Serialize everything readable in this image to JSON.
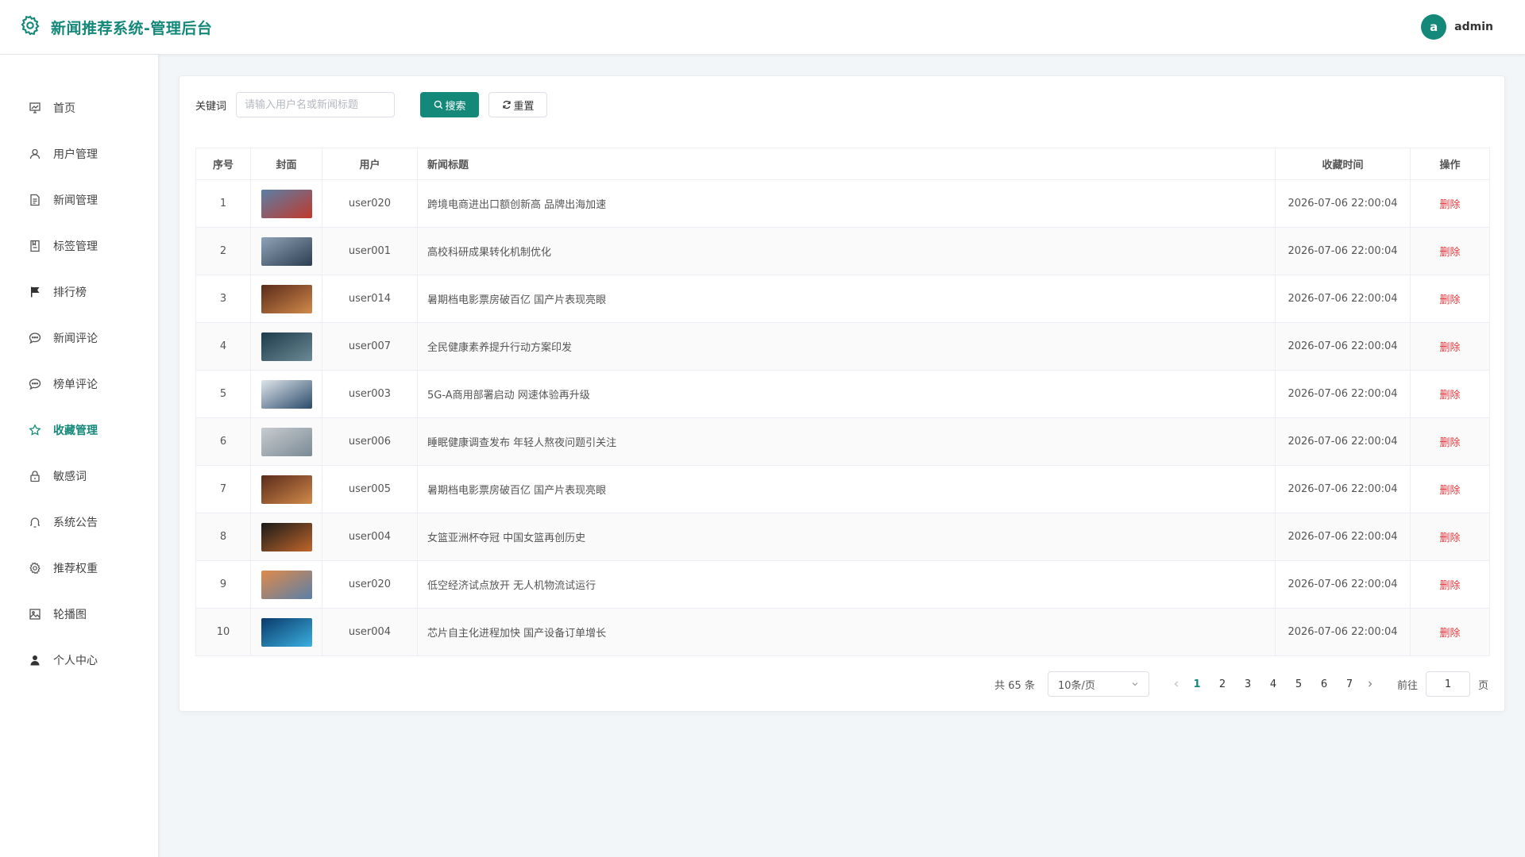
{
  "header": {
    "title": "新闻推荐系统-管理后台",
    "user_avatar": "a",
    "username": "admin",
    "accent": "#14897a"
  },
  "sidebar": {
    "items": [
      {
        "label": "首页",
        "icon": "dashboard-icon"
      },
      {
        "label": "用户管理",
        "icon": "user-icon"
      },
      {
        "label": "新闻管理",
        "icon": "document-icon"
      },
      {
        "label": "标签管理",
        "icon": "tag-icon"
      },
      {
        "label": "排行榜",
        "icon": "flag-icon"
      },
      {
        "label": "新闻评论",
        "icon": "comment-icon"
      },
      {
        "label": "榜单评论",
        "icon": "comment-icon"
      },
      {
        "label": "收藏管理",
        "icon": "star-icon",
        "active": true
      },
      {
        "label": "敏感词",
        "icon": "lock-icon"
      },
      {
        "label": "系统公告",
        "icon": "bell-icon"
      },
      {
        "label": "推荐权重",
        "icon": "gear-icon"
      },
      {
        "label": "轮播图",
        "icon": "image-icon"
      },
      {
        "label": "个人中心",
        "icon": "person-icon"
      }
    ]
  },
  "search": {
    "label": "关键词",
    "placeholder": "请输入用户名或新闻标题",
    "value": "",
    "search_label": "搜索",
    "reset_label": "重置"
  },
  "table": {
    "columns": [
      "序号",
      "封面",
      "用户",
      "新闻标题",
      "收藏时间",
      "操作"
    ],
    "delete_label": "删除",
    "rows": [
      {
        "no": "1",
        "user": "user020",
        "title": "跨境电商进出口额创新高 品牌出海加速",
        "time": "2026-07-06 22:00:04",
        "cover": [
          "#5a7fa8",
          "#c0392b"
        ]
      },
      {
        "no": "2",
        "user": "user001",
        "title": "高校科研成果转化机制优化",
        "time": "2026-07-06 22:00:04",
        "cover": [
          "#8fa3b8",
          "#2c3e50"
        ]
      },
      {
        "no": "3",
        "user": "user014",
        "title": "暑期档电影票房破百亿 国产片表现亮眼",
        "time": "2026-07-06 22:00:04",
        "cover": [
          "#5a2a1a",
          "#d18a4a"
        ]
      },
      {
        "no": "4",
        "user": "user007",
        "title": "全民健康素养提升行动方案印发",
        "time": "2026-07-06 22:00:04",
        "cover": [
          "#1f3b4a",
          "#6a8a95"
        ]
      },
      {
        "no": "5",
        "user": "user003",
        "title": "5G-A商用部署启动 网速体验再升级",
        "time": "2026-07-06 22:00:04",
        "cover": [
          "#dfe5ea",
          "#2a4a6a"
        ]
      },
      {
        "no": "6",
        "user": "user006",
        "title": "睡眠健康调查发布 年轻人熬夜问题引关注",
        "time": "2026-07-06 22:00:04",
        "cover": [
          "#c8ccd0",
          "#7a8a95"
        ]
      },
      {
        "no": "7",
        "user": "user005",
        "title": "暑期档电影票房破百亿 国产片表现亮眼",
        "time": "2026-07-06 22:00:04",
        "cover": [
          "#5a2a1a",
          "#d18a4a"
        ]
      },
      {
        "no": "8",
        "user": "user004",
        "title": "女篮亚洲杯夺冠 中国女篮再创历史",
        "time": "2026-07-06 22:00:04",
        "cover": [
          "#1a1a1a",
          "#c0662a"
        ]
      },
      {
        "no": "9",
        "user": "user020",
        "title": "低空经济试点放开 无人机物流试运行",
        "time": "2026-07-06 22:00:04",
        "cover": [
          "#e08a4a",
          "#5a7fa8"
        ]
      },
      {
        "no": "10",
        "user": "user004",
        "title": "芯片自主化进程加快 国产设备订单增长",
        "time": "2026-07-06 22:00:04",
        "cover": [
          "#0a3a6a",
          "#3ab0e0"
        ]
      }
    ]
  },
  "pagination": {
    "total_text": "共 65 条",
    "page_size": "10条/页",
    "pages": [
      "1",
      "2",
      "3",
      "4",
      "5",
      "6",
      "7"
    ],
    "current": "1",
    "goto_label": "前往",
    "goto_value": "1",
    "goto_suffix": "页"
  }
}
